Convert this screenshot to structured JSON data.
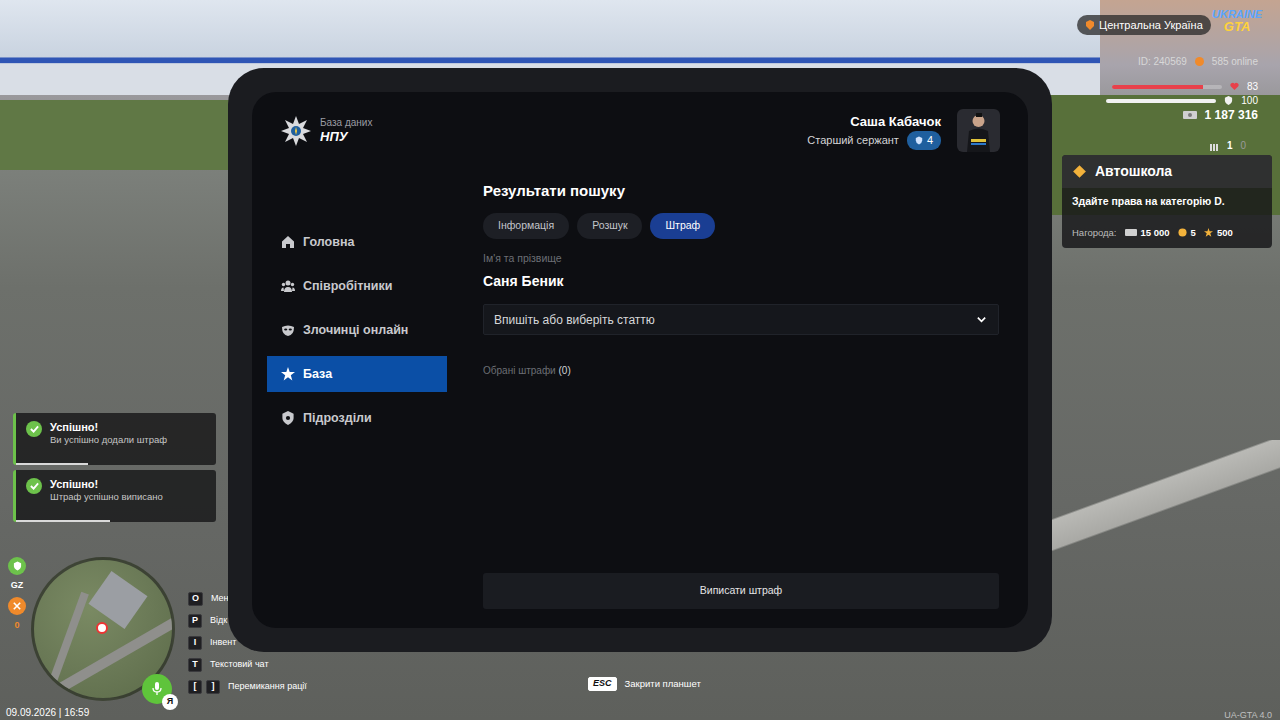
{
  "hud": {
    "region": "Центральна Україна",
    "logo_top": "UKRAINE",
    "logo_bottom": "GTA",
    "id": "ID: 240569",
    "online": "585 online",
    "health": {
      "value": "83",
      "level": 0.83
    },
    "armor": {
      "value": "100",
      "level": 1.0
    },
    "money": "1 187 316",
    "ammo": {
      "loaded": "1",
      "reserve": "0"
    }
  },
  "quest": {
    "title": "Автошкола",
    "text": "Здайте права на категорію D.",
    "reward_label": "Нагорода:",
    "rewards": [
      {
        "value": "15 000",
        "kind": "money"
      },
      {
        "value": "5",
        "kind": "coin"
      },
      {
        "value": "500",
        "kind": "star"
      }
    ]
  },
  "tablet": {
    "db_label": "База даних",
    "org": "НПУ",
    "user": {
      "name": "Саша Кабачок",
      "rank": "Старший сержант",
      "level": "4"
    },
    "sidebar": [
      {
        "label": "Головна",
        "selected": false
      },
      {
        "label": "Співробітники",
        "selected": false
      },
      {
        "label": "Злочинці онлайн",
        "selected": false
      },
      {
        "label": "База",
        "selected": true
      },
      {
        "label": "Підрозділи",
        "selected": false
      }
    ],
    "heading": "Результати пошуку",
    "tabs": [
      {
        "label": "Інформація",
        "selected": false
      },
      {
        "label": "Розшук",
        "selected": false
      },
      {
        "label": "Штраф",
        "selected": true
      }
    ],
    "name_label": "Ім'я та прізвище",
    "name": "Саня Беник",
    "article_select": {
      "placeholder": "Впишіть або виберіть статтю"
    },
    "selected_label": "Обрані штрафи",
    "selected_count": "(0)",
    "submit": "Виписати штраф"
  },
  "notifications": [
    {
      "title": "Успішно!",
      "text": "Ви успішно додали штраф",
      "level": 0.6
    },
    {
      "title": "Успішно!",
      "text": "Штраф успішно виписано",
      "level": 0.78
    }
  ],
  "status": {
    "gz": "GZ",
    "wanted": "0"
  },
  "hints": [
    {
      "keys": [
        "O"
      ],
      "label": "Мен"
    },
    {
      "keys": [
        "P"
      ],
      "label": "Відк"
    },
    {
      "keys": [
        "I"
      ],
      "label": "Інвент"
    },
    {
      "keys": [
        "T"
      ],
      "label": "Текстовий чат"
    },
    {
      "keys": [
        "[",
        "]"
      ],
      "label": "Перемикання рації"
    }
  ],
  "mic": "Я",
  "close_hint": {
    "key": "ESC",
    "label": "Закрити планшет"
  },
  "datetime": "09.09.2026 | 16:59",
  "version": "UA-GTA 4.0"
}
